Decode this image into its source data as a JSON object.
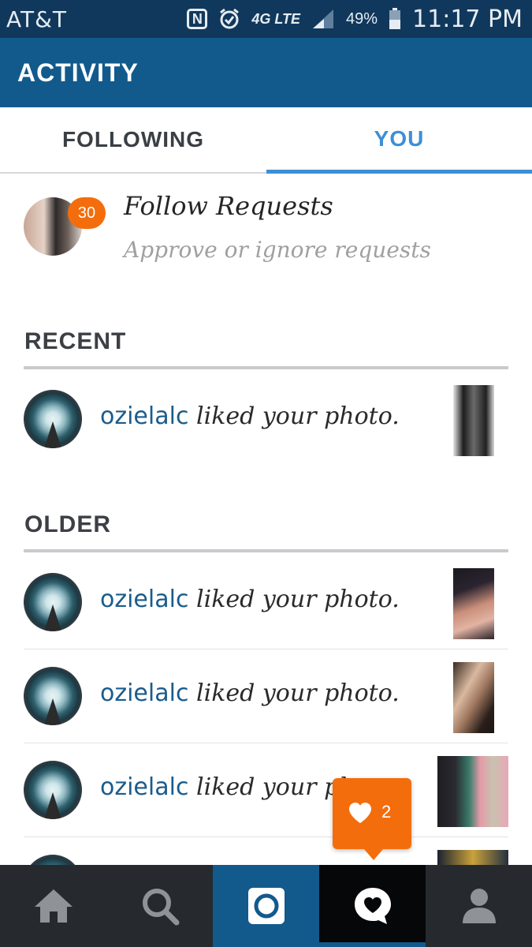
{
  "status_bar": {
    "carrier": "AT&T",
    "battery_percent": "49%",
    "time": "11:17 PM",
    "icons": [
      "nfc-icon",
      "alarm-icon",
      "lte-4g-icon",
      "signal-icon",
      "battery-icon"
    ],
    "network_label": "4G LTE"
  },
  "header": {
    "title": "ACTIVITY"
  },
  "tabs": [
    {
      "label": "FOLLOWING",
      "selected": false
    },
    {
      "label": "YOU",
      "selected": true
    }
  ],
  "follow_requests": {
    "title": "Follow Requests",
    "subtitle": "Approve or ignore requests",
    "badge_count": "30"
  },
  "sections": {
    "recent": "RECENT",
    "older": "OLDER"
  },
  "activity": {
    "recent": [
      {
        "user": "ozielalc",
        "action": "liked your photo."
      }
    ],
    "older": [
      {
        "user": "ozielalc",
        "action": "liked your photo."
      },
      {
        "user": "ozielalc",
        "action": "liked your photo."
      },
      {
        "user": "ozielalc",
        "action": "liked your photo."
      }
    ]
  },
  "notification_bubble": {
    "icon": "heart-icon",
    "count": "2"
  },
  "bottom_nav": [
    {
      "name": "home",
      "icon": "home-icon"
    },
    {
      "name": "search",
      "icon": "search-icon"
    },
    {
      "name": "camera",
      "icon": "camera-icon"
    },
    {
      "name": "activity",
      "icon": "activity-icon",
      "selected": true
    },
    {
      "name": "profile",
      "icon": "profile-icon"
    }
  ],
  "colors": {
    "status_bar": "#10385c",
    "app_bar": "#125a8c",
    "accent": "#3d8fd6",
    "badge": "#f46d0c",
    "nav_bg": "#262a2f",
    "username": "#1b5c8c"
  }
}
